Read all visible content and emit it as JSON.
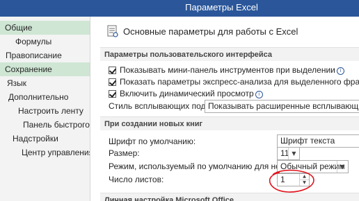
{
  "window": {
    "title": "Параметры Excel"
  },
  "sidebar": {
    "items": [
      {
        "label": "Общие",
        "selected": true
      },
      {
        "label": "Формулы",
        "selected": false
      },
      {
        "label": "Правописание",
        "selected": false
      },
      {
        "label": "Сохранение",
        "selected": true
      },
      {
        "label": "Язык",
        "selected": false
      },
      {
        "label": "Дополнительно",
        "selected": false
      },
      {
        "label": "Настроить ленту",
        "selected": false
      },
      {
        "label": "Панель быстрого доступа",
        "selected": false
      },
      {
        "label": "Надстройки",
        "selected": false
      },
      {
        "label": "Центр управления безопасностью",
        "selected": false
      }
    ]
  },
  "main": {
    "header": "Основные параметры для работы с Excel",
    "ui_section": {
      "title": "Параметры пользовательского интерфейса",
      "options": [
        {
          "label": "Показывать мини-панель инструментов при выделении",
          "checked": true,
          "info": true
        },
        {
          "label": "Показать параметры экспресс-анализа для выделенного фрагмента",
          "checked": true,
          "info": false
        },
        {
          "label": "Включить динамический просмотр",
          "checked": true,
          "info": true
        }
      ],
      "tooltip_style_label": "Стиль всплывающих подсказок:",
      "tooltip_style_value": "Показывать расширенные всплывающие подсказки"
    },
    "new_workbook_section": {
      "title": "При создании новых книг",
      "default_font_label": "Шрифт по умолчанию:",
      "default_font_value": "Шрифт текста",
      "size_label": "Размер:",
      "size_value": "11",
      "view_label": "Режим, используемый по умолчанию для новых листов:",
      "view_value": "Обычный режим",
      "sheets_label": "Число листов:",
      "sheets_value": "1"
    },
    "personal_section": {
      "title": "Личная настройка Microsoft Office"
    }
  },
  "colors": {
    "titlebar": "#2b579a",
    "nav_selected": "#cfe6d4",
    "annotation": "#e0141e"
  },
  "icons": {
    "info": "i",
    "dropdown": "▼",
    "spin_up": "▲",
    "spin_down": "▼"
  }
}
